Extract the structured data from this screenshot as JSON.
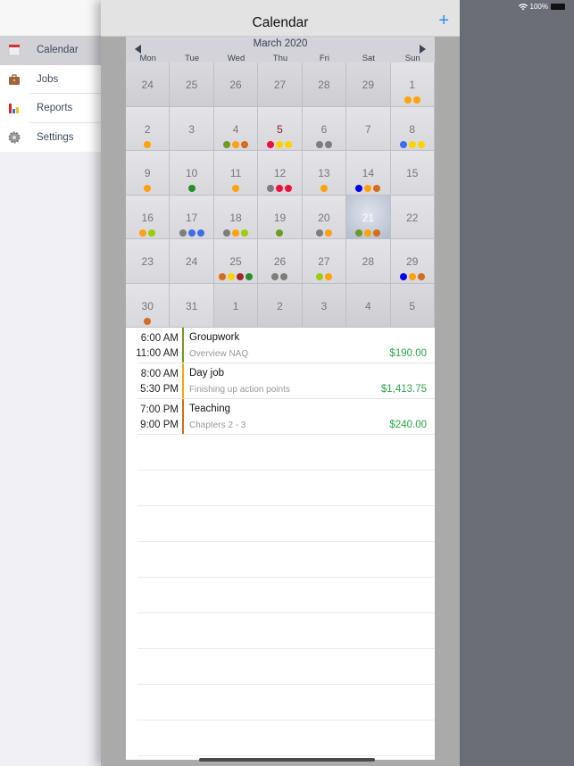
{
  "status_bar": {
    "battery_text": "100%",
    "wifi_icon": "wifi-icon"
  },
  "sidebar": {
    "items": [
      {
        "label": "Calendar",
        "icon": "calendar-icon",
        "active": true
      },
      {
        "label": "Jobs",
        "icon": "briefcase-icon",
        "active": false
      },
      {
        "label": "Reports",
        "icon": "bar-chart-icon",
        "active": false
      },
      {
        "label": "Settings",
        "icon": "gear-icon",
        "active": false
      }
    ]
  },
  "navbar": {
    "title": "Calendar",
    "add_label": "+"
  },
  "calendar": {
    "month_label": "March 2020",
    "weekdays": [
      "Mon",
      "Tue",
      "Wed",
      "Thu",
      "Fri",
      "Sat",
      "Sun"
    ],
    "colors": {
      "orange": "#ffa10a",
      "olive": "#6f9a23",
      "burnt": "#d56b1c",
      "red": "#ee0f3b",
      "yellow": "#ffd200",
      "gray": "#7d7d7d",
      "blue": "#3d6ee6",
      "green": "#23912b",
      "navy": "#0000ee",
      "lime": "#9ccc0a",
      "maroon": "#a3252b"
    },
    "days": [
      {
        "n": "24",
        "outside": true,
        "dots": []
      },
      {
        "n": "25",
        "outside": true,
        "dots": []
      },
      {
        "n": "26",
        "outside": true,
        "dots": []
      },
      {
        "n": "27",
        "outside": true,
        "dots": []
      },
      {
        "n": "28",
        "outside": true,
        "dots": []
      },
      {
        "n": "29",
        "outside": true,
        "dots": []
      },
      {
        "n": "1",
        "dots": [
          "orange",
          "orange"
        ]
      },
      {
        "n": "2",
        "dots": [
          "orange"
        ]
      },
      {
        "n": "3",
        "dots": []
      },
      {
        "n": "4",
        "dots": [
          "olive",
          "orange",
          "burnt"
        ]
      },
      {
        "n": "5",
        "today": true,
        "dots": [
          "red",
          "yellow",
          "yellow"
        ]
      },
      {
        "n": "6",
        "dots": [
          "gray",
          "gray"
        ]
      },
      {
        "n": "7",
        "dots": []
      },
      {
        "n": "8",
        "dots": [
          "blue",
          "yellow",
          "yellow"
        ]
      },
      {
        "n": "9",
        "dots": [
          "orange"
        ]
      },
      {
        "n": "10",
        "dots": [
          "green"
        ]
      },
      {
        "n": "11",
        "dots": [
          "orange"
        ]
      },
      {
        "n": "12",
        "dots": [
          "gray",
          "red",
          "red"
        ]
      },
      {
        "n": "13",
        "dots": [
          "orange"
        ]
      },
      {
        "n": "14",
        "dots": [
          "navy",
          "orange",
          "burnt"
        ]
      },
      {
        "n": "15",
        "dots": []
      },
      {
        "n": "16",
        "dots": [
          "orange",
          "lime"
        ]
      },
      {
        "n": "17",
        "dots": [
          "gray",
          "blue",
          "blue"
        ]
      },
      {
        "n": "18",
        "dots": [
          "gray",
          "orange",
          "lime"
        ]
      },
      {
        "n": "19",
        "dots": [
          "olive"
        ]
      },
      {
        "n": "20",
        "dots": [
          "gray",
          "orange"
        ]
      },
      {
        "n": "21",
        "selected": true,
        "dots": [
          "olive",
          "orange",
          "burnt"
        ]
      },
      {
        "n": "22",
        "dots": []
      },
      {
        "n": "23",
        "dots": []
      },
      {
        "n": "24",
        "dots": []
      },
      {
        "n": "25",
        "dots": [
          "burnt",
          "yellow",
          "maroon",
          "green"
        ]
      },
      {
        "n": "26",
        "dots": [
          "gray",
          "gray"
        ]
      },
      {
        "n": "27",
        "dots": [
          "lime",
          "orange"
        ]
      },
      {
        "n": "28",
        "dots": []
      },
      {
        "n": "29",
        "dots": [
          "navy",
          "orange",
          "burnt"
        ]
      },
      {
        "n": "30",
        "dots": [
          "burnt"
        ]
      },
      {
        "n": "31",
        "dots": []
      },
      {
        "n": "1",
        "outside": true,
        "dots": []
      },
      {
        "n": "2",
        "outside": true,
        "dots": []
      },
      {
        "n": "3",
        "outside": true,
        "dots": []
      },
      {
        "n": "4",
        "outside": true,
        "dots": []
      },
      {
        "n": "5",
        "outside": true,
        "dots": []
      }
    ]
  },
  "events": [
    {
      "start": "6:00 AM",
      "end": "11:00 AM",
      "name": "Groupwork",
      "description": "Overview NAQ",
      "amount": "$190.00",
      "color": "#6f9a23"
    },
    {
      "start": "8:00 AM",
      "end": "5:30 PM",
      "name": "Day job",
      "description": "Finishing up action points",
      "amount": "$1,413.75",
      "color": "#ffa10a"
    },
    {
      "start": "7:00 PM",
      "end": "9:00 PM",
      "name": "Teaching",
      "description": "Chapters 2 - 3",
      "amount": "$240.00",
      "color": "#d56b1c"
    }
  ]
}
